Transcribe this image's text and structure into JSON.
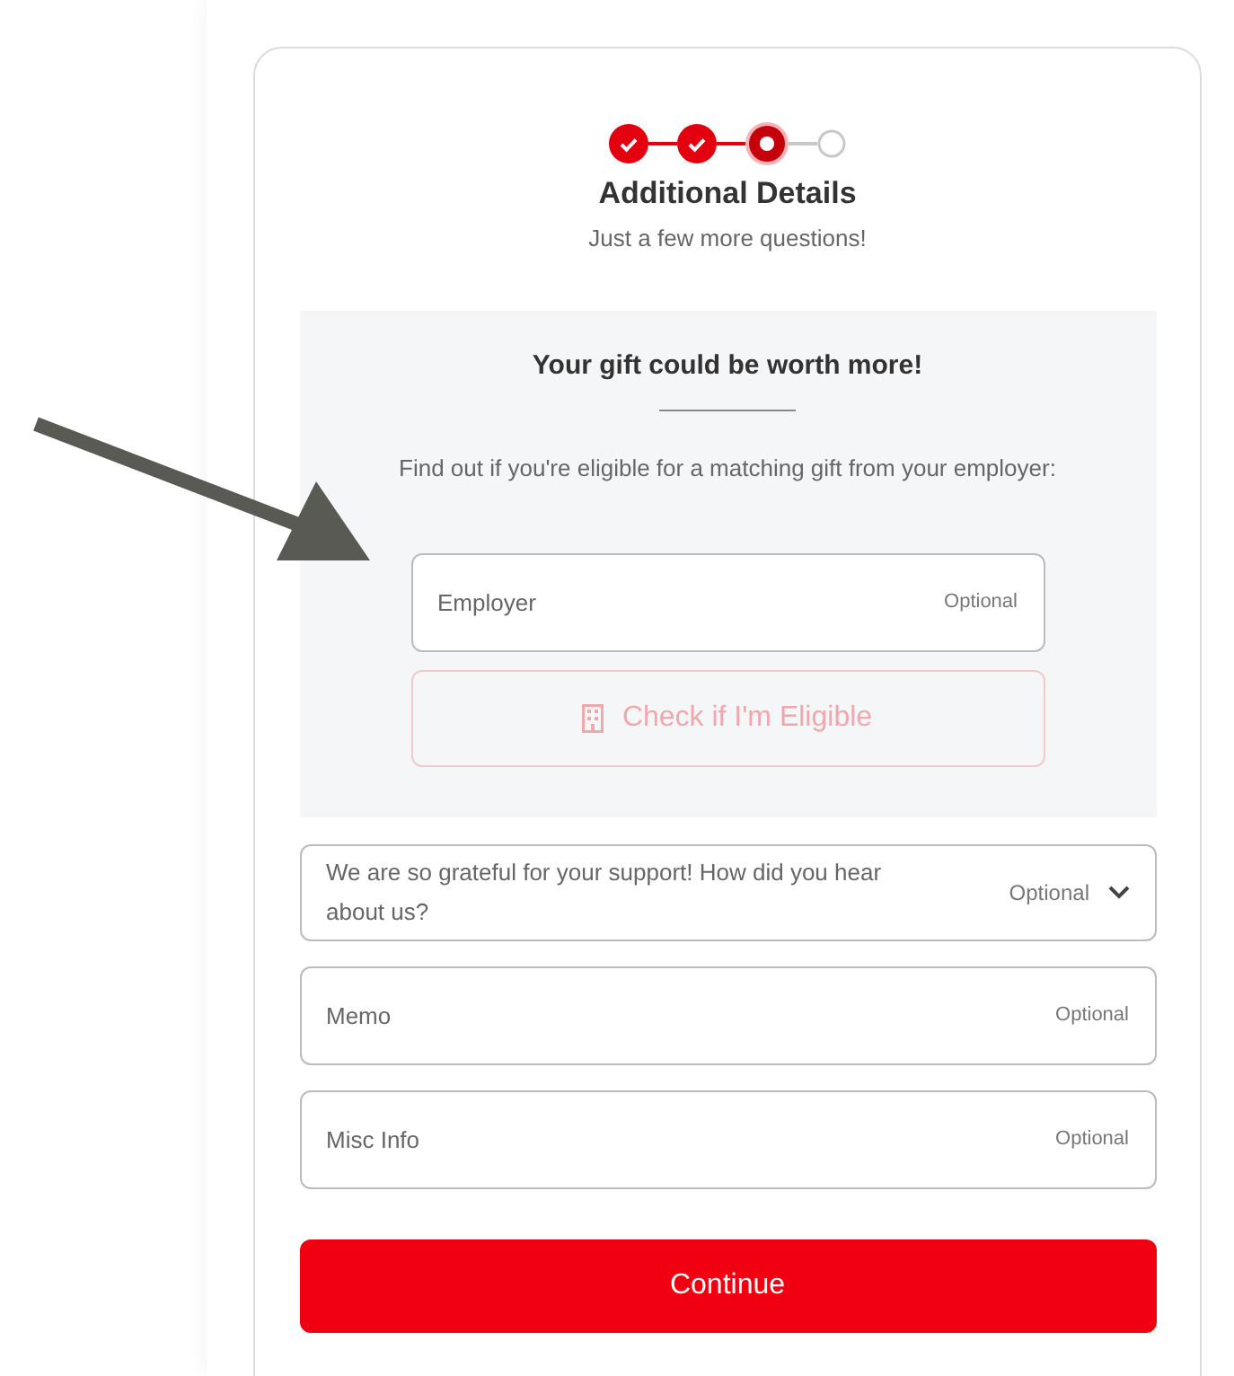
{
  "steps": [
    {
      "current": false
    },
    {
      "current": false
    },
    {
      "current": true
    },
    {
      "current": false
    }
  ],
  "header": {
    "title": "Additional Details",
    "subtitle": "Just a few more questions!"
  },
  "matching_gift": {
    "title": "Your gift could be worth more!",
    "description": "Find out if you're eligible for a matching gift from your employer:",
    "employer_field": {
      "placeholder": "Employer",
      "hint": "Optional"
    },
    "check_button": {
      "label": "Check if I'm Eligible",
      "disabled": true
    }
  },
  "fields": [
    {
      "kind": "select",
      "placeholder": "We are so grateful for your support! How did you hear about us?",
      "hint": "Optional"
    },
    {
      "kind": "text",
      "placeholder": "Memo",
      "hint": "Optional"
    },
    {
      "kind": "text",
      "placeholder": "Misc Info",
      "hint": "Optional"
    }
  ],
  "continue_button": {
    "label": "Continue"
  }
}
